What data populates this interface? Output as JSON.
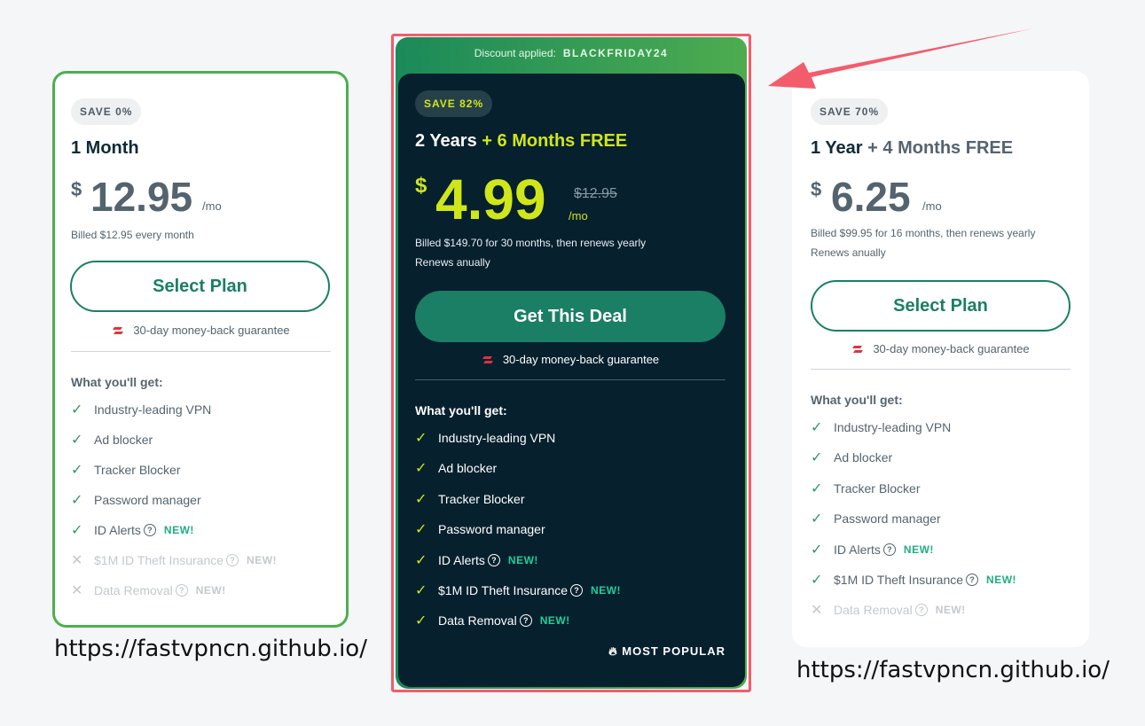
{
  "plans": {
    "monthly": {
      "save_badge": "SAVE 0%",
      "name": "1 Month",
      "name_extra": "",
      "currency": "$",
      "price": "12.95",
      "per": "/mo",
      "billed": "Billed $12.95 every month",
      "renews": "",
      "button": "Select Plan",
      "guarantee": "30-day money-back guarantee",
      "features_title": "What you'll get:",
      "features": [
        {
          "label": "Industry-leading VPN",
          "included": true,
          "new": false,
          "info": false
        },
        {
          "label": "Ad blocker",
          "included": true,
          "new": false,
          "info": false
        },
        {
          "label": "Tracker Blocker",
          "included": true,
          "new": false,
          "info": false
        },
        {
          "label": "Password manager",
          "included": true,
          "new": false,
          "info": false
        },
        {
          "label": "ID Alerts",
          "included": true,
          "new": true,
          "info": true
        },
        {
          "label": "$1M ID Theft Insurance",
          "included": false,
          "new": true,
          "info": true
        },
        {
          "label": "Data Removal",
          "included": false,
          "new": true,
          "info": true
        }
      ]
    },
    "two_year": {
      "discount_label": "Discount applied:",
      "discount_code": "BLACKFRIDAY24",
      "save_badge": "SAVE 82%",
      "name": "2 Years",
      "name_extra": "+ 6 Months FREE",
      "currency": "$",
      "price": "4.99",
      "old_price": "$12.95",
      "per": "/mo",
      "billed": "Billed $149.70 for 30 months, then renews yearly",
      "renews": "Renews anually",
      "button": "Get This Deal",
      "guarantee": "30-day money-back guarantee",
      "features_title": "What you'll get:",
      "features": [
        {
          "label": "Industry-leading VPN",
          "included": true,
          "new": false,
          "info": false
        },
        {
          "label": "Ad blocker",
          "included": true,
          "new": false,
          "info": false
        },
        {
          "label": "Tracker Blocker",
          "included": true,
          "new": false,
          "info": false
        },
        {
          "label": "Password manager",
          "included": true,
          "new": false,
          "info": false
        },
        {
          "label": "ID Alerts",
          "included": true,
          "new": true,
          "info": true
        },
        {
          "label": "$1M ID Theft Insurance",
          "included": true,
          "new": true,
          "info": true
        },
        {
          "label": "Data Removal",
          "included": true,
          "new": true,
          "info": true
        }
      ],
      "popular": "MOST POPULAR"
    },
    "one_year": {
      "save_badge": "SAVE 70%",
      "name": "1 Year",
      "name_extra": "+ 4 Months FREE",
      "currency": "$",
      "price": "6.25",
      "per": "/mo",
      "billed": "Billed $99.95 for 16 months, then renews yearly",
      "renews": "Renews anually",
      "button": "Select Plan",
      "guarantee": "30-day money-back guarantee",
      "features_title": "What you'll get:",
      "features": [
        {
          "label": "Industry-leading VPN",
          "included": true,
          "new": false,
          "info": false
        },
        {
          "label": "Ad blocker",
          "included": true,
          "new": false,
          "info": false
        },
        {
          "label": "Tracker Blocker",
          "included": true,
          "new": false,
          "info": false
        },
        {
          "label": "Password manager",
          "included": true,
          "new": false,
          "info": false
        },
        {
          "label": "ID Alerts",
          "included": true,
          "new": true,
          "info": true
        },
        {
          "label": "$1M ID Theft Insurance",
          "included": true,
          "new": true,
          "info": true
        },
        {
          "label": "Data Removal",
          "included": false,
          "new": true,
          "info": true
        }
      ]
    }
  },
  "new_label": "NEW!",
  "info_glyph": "?",
  "check_glyph": "✓",
  "cross_glyph": "✕",
  "captions": {
    "left_url": "https://fastvpncn.github.io/",
    "right_url": "https://fastvpncn.github.io/"
  },
  "colors": {
    "brand_green": "#1a7f64",
    "accent_lime": "#cfe61a",
    "dark_bg": "#06202e",
    "highlight_red": "#f25c6b",
    "selected_border": "#4caf50"
  }
}
